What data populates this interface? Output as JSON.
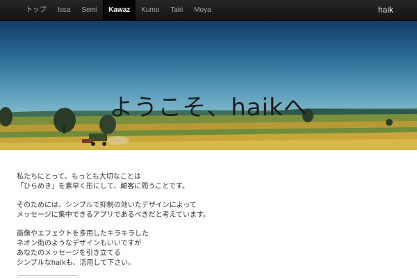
{
  "nav": {
    "items": [
      {
        "label": "トップ",
        "active": false
      },
      {
        "label": "Issa",
        "active": false
      },
      {
        "label": "Semi",
        "active": false
      },
      {
        "label": "Kawaz",
        "active": true
      },
      {
        "label": "Kumo",
        "active": false
      },
      {
        "label": "Taki",
        "active": false
      },
      {
        "label": "Moya",
        "active": false
      }
    ],
    "brand": "haik"
  },
  "hero": {
    "title": "ようこそ、haikへ",
    "image": "countryside-wheat-field-with-harvester"
  },
  "content": {
    "paragraphs": [
      [
        "私たちにとって、もっとも大切なことは",
        "「ひらめき」を素早く形にして、顧客に問うことです。"
      ],
      [
        "そのためには、シンプルで抑制の効いたデザインによって",
        "メッセージに集中できるアプリであるべきだと考えています。"
      ],
      [
        "画像やエフェクトを多用したキラキラした",
        "ネオン街のようなデザインもいいですが",
        "あなたのメッセージを引き立てる",
        "シンプルなhaikも、活用して下さい。"
      ]
    ]
  },
  "colors": {
    "navbar": "#1b1b1b",
    "nav_active": "#050505",
    "sky_top": "#123c68",
    "field": "#c9a63a"
  }
}
